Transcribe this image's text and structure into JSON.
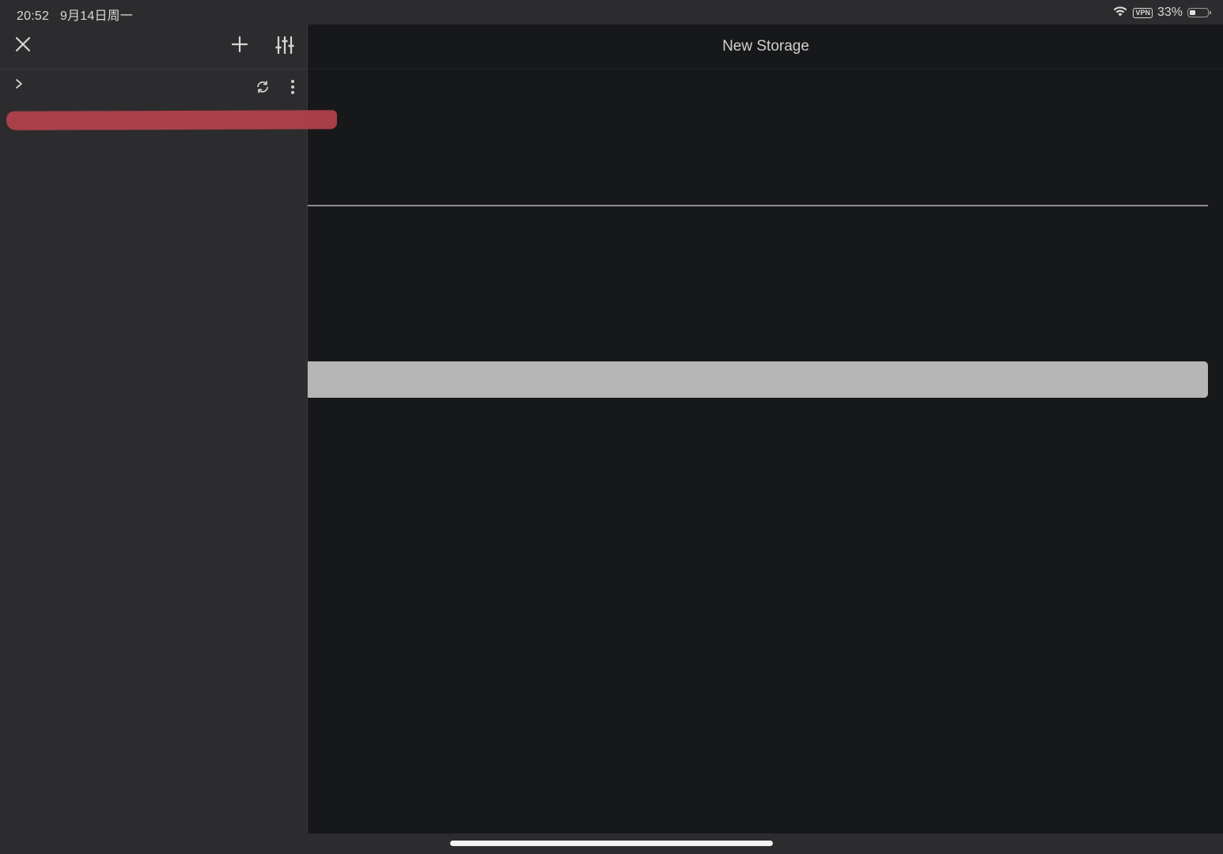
{
  "status_bar": {
    "time": "20:52",
    "date": "9月14日周一",
    "vpn_label": "VPN",
    "battery_text": "33%",
    "battery_level": 0.33
  },
  "sidebar": {
    "toolbar": {
      "close_icon": "close-icon",
      "add_icon": "plus-icon",
      "settings_icon": "sliders-icon"
    },
    "row": {
      "expand_icon": "chevron-right-icon",
      "sync_icon": "sync-icon",
      "more_icon": "more-vertical-icon"
    },
    "redaction_color": "#b4424c"
  },
  "main": {
    "title": "New Storage",
    "name_input": {
      "value": "",
      "placeholder": ""
    },
    "primary_button_label": "",
    "button_color": "#b6b6b6"
  },
  "colors": {
    "background": "#2c2c2e",
    "main_background": "#17181a",
    "text": "#d0d0d0"
  }
}
